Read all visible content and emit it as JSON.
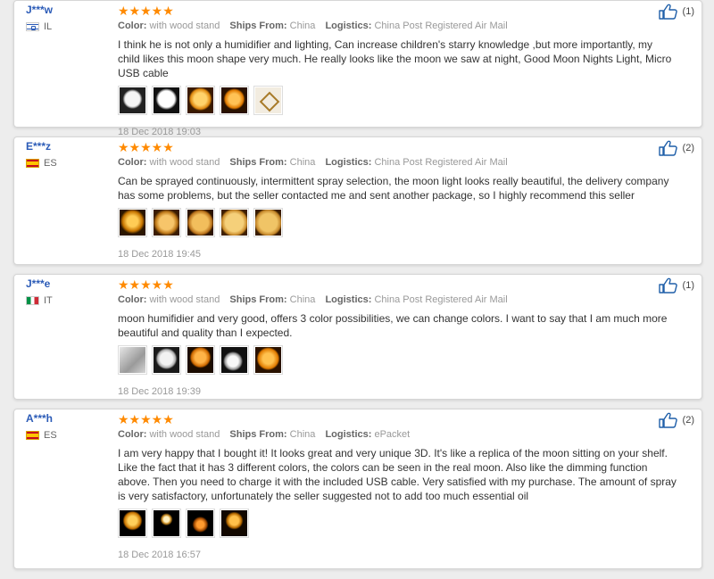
{
  "meta_labels": {
    "color": "Color:",
    "ships_from": "Ships From:",
    "logistics": "Logistics:"
  },
  "reviews": [
    {
      "user": "J***w",
      "country_code": "IL",
      "stars": "★★★★★",
      "color_value": "with wood stand",
      "ships_from_value": "China",
      "logistics_value": "China Post Registered Air Mail",
      "text": "I think he is not only a humidifier and lighting, Can increase children's starry knowledge ,but more importantly, my child likes this moon shape very much. He really looks like the moon we saw at night, Good Moon Nights Light, Micro USB cable",
      "helpful_count": "(1)",
      "date": "18 Dec 2018 19:03",
      "photos": [
        "white moon lamp",
        "white moon lamp",
        "orange moon lamp",
        "orange moon lamp",
        "moon lamp box"
      ]
    },
    {
      "user": "E***z",
      "country_code": "ES",
      "stars": "★★★★★",
      "color_value": "with wood stand",
      "ships_from_value": "China",
      "logistics_value": "China Post Registered Air Mail",
      "text": "Can be sprayed continuously, intermittent spray selection, the moon light looks really beautiful, the delivery company has some problems, but the seller contacted me and sent another package, so I highly recommend this seller",
      "helpful_count": "(2)",
      "date": "18 Dec 2018 19:45",
      "photos": [
        "orange moon lamp",
        "orange moon lamp",
        "orange moon lamp",
        "orange moon lamp",
        "orange moon lamp"
      ]
    },
    {
      "user": "J***e",
      "country_code": "IT",
      "stars": "★★★★★",
      "color_value": "with wood stand",
      "ships_from_value": "China",
      "logistics_value": "China Post Registered Air Mail",
      "text": "moon humifidier and very good, offers 3 color possibilities, we can change colors. I want to say that I am much more beautiful and quality than I expected.",
      "helpful_count": "(1)",
      "date": "18 Dec 2018 19:39",
      "photos": [
        "package",
        "white moon lamp",
        "orange moon lamp",
        "white moon lamp",
        "orange moon lamp"
      ]
    },
    {
      "user": "A***h",
      "country_code": "ES",
      "stars": "★★★★★",
      "color_value": "with wood stand",
      "ships_from_value": "China",
      "logistics_value": "ePacket",
      "text": "I am very happy that I bought it! It looks great and very unique 3D. It's like a replica of the moon sitting on your shelf. Like the fact that it has 3 different colors, the colors can be seen in the real moon. Also like the dimming function above. Then you need to charge it with the included USB cable. Very satisfied with my purchase. The amount of spray is very satisfactory, unfortunately the seller suggested not to add too much essential oil",
      "helpful_count": "(2)",
      "date": "18 Dec 2018 16:57",
      "photos": [
        "orange moon lamp dark",
        "orange moon lamp dark",
        "orange moon lamp dark",
        "orange moon lamp dark"
      ]
    }
  ],
  "icons": {
    "helpful": "thumbs-up-icon",
    "rating": "star-icon"
  },
  "colors": {
    "star": "#ff8a00",
    "username": "#2b5bb7",
    "icon": "#1f5fa9"
  }
}
